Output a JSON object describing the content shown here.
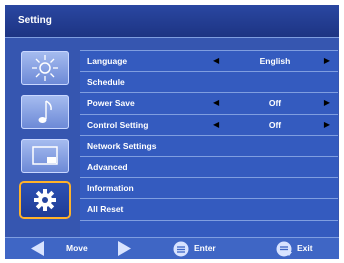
{
  "title": "Setting",
  "sidebar": {
    "items": [
      {
        "icon": "sun-icon",
        "selected": false
      },
      {
        "icon": "music-note-icon",
        "selected": false
      },
      {
        "icon": "screen-icon",
        "selected": false
      },
      {
        "icon": "gear-icon",
        "selected": true
      }
    ]
  },
  "menu": {
    "items": [
      {
        "label": "Language",
        "value": "English",
        "has_arrows": true
      },
      {
        "label": "Schedule",
        "value": "",
        "has_arrows": false
      },
      {
        "label": "Power Save",
        "value": "Off",
        "has_arrows": true
      },
      {
        "label": "Control Setting",
        "value": "Off",
        "has_arrows": true
      },
      {
        "label": "Network Settings",
        "value": "",
        "has_arrows": false
      },
      {
        "label": "Advanced",
        "value": "",
        "has_arrows": false
      },
      {
        "label": "Information",
        "value": "",
        "has_arrows": false
      },
      {
        "label": "All Reset",
        "value": "",
        "has_arrows": false
      }
    ],
    "left_arrow": "◀",
    "right_arrow": "▶"
  },
  "footer": {
    "move_label": "Move",
    "enter_label": "Enter",
    "exit_label": "Exit"
  },
  "colors": {
    "background": "#3656b0",
    "title_bar": "#1d3483",
    "selection_highlight": "#ffb22a"
  }
}
